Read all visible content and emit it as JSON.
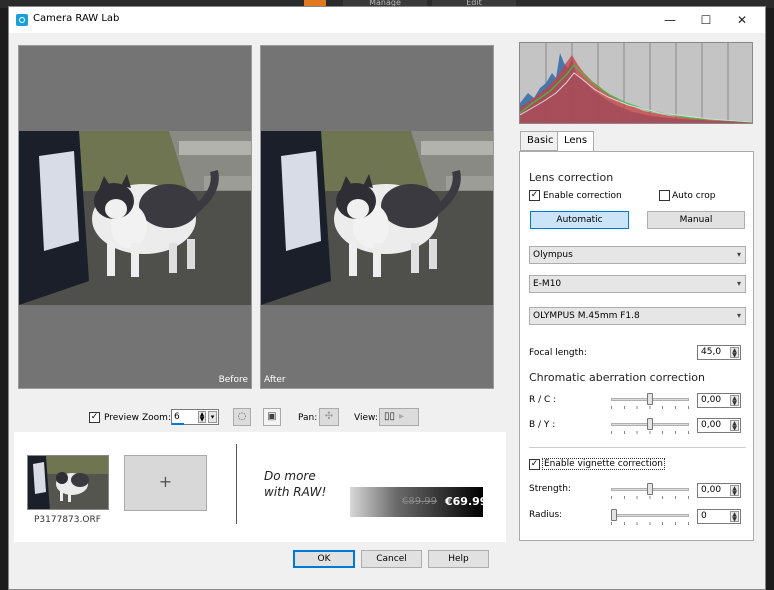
{
  "host": {
    "tabs": [
      "Manage",
      "Edit"
    ]
  },
  "window": {
    "title": "Camera RAW Lab",
    "minimize": "—",
    "maximize": "☐",
    "close": "✕"
  },
  "previews": {
    "before_label": "Before",
    "after_label": "After"
  },
  "toolbar": {
    "preview_label": "Preview",
    "preview_checked": true,
    "zoom_label": "Zoom:",
    "zoom_value": "6",
    "pan_label": "Pan:",
    "view_label": "View:"
  },
  "filmstrip": {
    "thumb_filename": "P3177873.ORF",
    "add_label": "+"
  },
  "promo": {
    "text": "Do more with RAW!",
    "old_price": "€89.99",
    "new_price": "€69.99"
  },
  "buttons": {
    "ok": "OK",
    "cancel": "Cancel",
    "help": "Help"
  },
  "tabs": {
    "basic": "Basic",
    "lens": "Lens"
  },
  "lens": {
    "section_title": "Lens correction",
    "enable_correction_label": "Enable correction",
    "enable_correction_checked": true,
    "auto_crop_label": "Auto crop",
    "auto_crop_checked": false,
    "automatic_label": "Automatic",
    "manual_label": "Manual",
    "maker": "Olympus",
    "camera": "E-M10",
    "lens_model": "OLYMPUS M.45mm F1.8",
    "focal_length_label": "Focal length:",
    "focal_length_value": "45,0",
    "chromatic_title": "Chromatic aberration correction",
    "rc_label": "R / C :",
    "rc_value": "0,00",
    "by_label": "B / Y :",
    "by_value": "0,00",
    "vignette_label": "Enable vignette correction",
    "vignette_checked": true,
    "strength_label": "Strength:",
    "strength_value": "0,00",
    "radius_label": "Radius:",
    "radius_value": "0"
  },
  "colors": {
    "accent": "#0078d7",
    "title_icon": "#1aa0d8",
    "automatic_bg": "#cce4f7"
  },
  "icons": {
    "title": "camera-raw-icon",
    "zoom_stepper": "stepper-icon",
    "auto_fit": "fit-icon",
    "full": "full-view-icon",
    "pan": "pan-icon",
    "view": "split-view-icon",
    "dropdown": "chevron-down-icon"
  }
}
